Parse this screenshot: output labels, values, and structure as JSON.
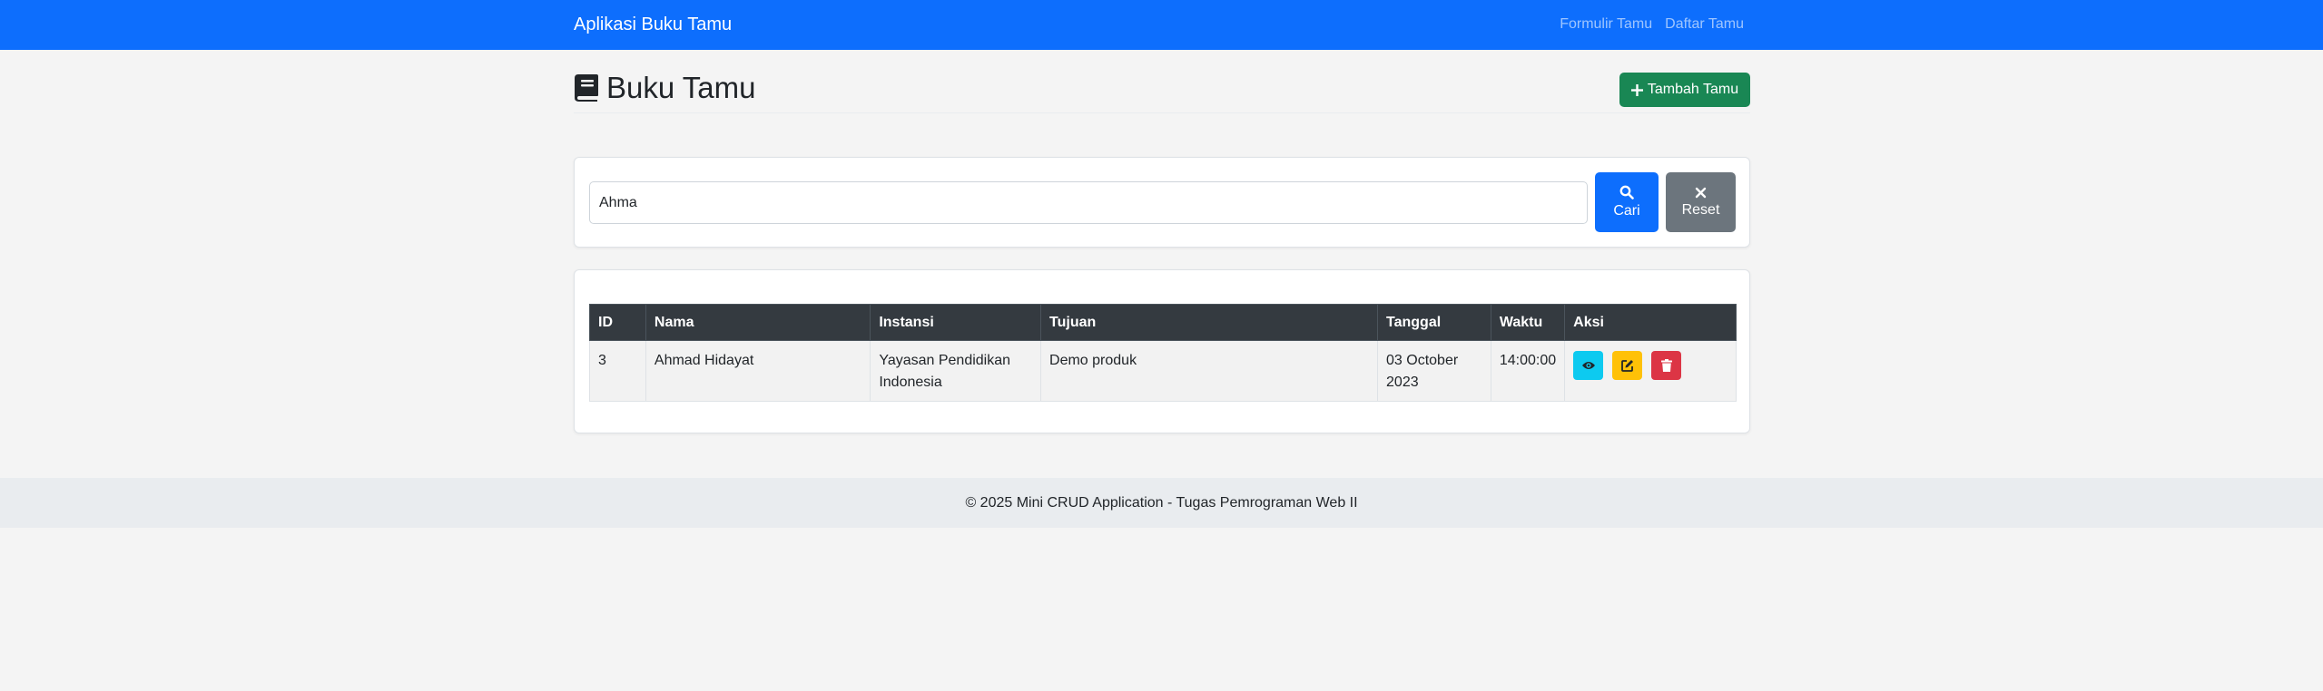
{
  "navbar": {
    "brand": "Aplikasi Buku Tamu",
    "links": [
      "Formulir Tamu",
      "Daftar Tamu"
    ]
  },
  "header": {
    "title": "Buku Tamu",
    "icon": "book-icon",
    "add_button_label": "Tambah Tamu"
  },
  "search": {
    "value": "Ahma",
    "search_label": "Cari",
    "reset_label": "Reset"
  },
  "table": {
    "columns": [
      "ID",
      "Nama",
      "Instansi",
      "Tujuan",
      "Tanggal",
      "Waktu",
      "Aksi"
    ],
    "rows": [
      {
        "id": "3",
        "nama": "Ahmad Hidayat",
        "instansi": "Yayasan Pendidikan Indonesia",
        "tujuan": "Demo produk",
        "tanggal": "03 October 2023",
        "waktu": "14:00:00",
        "actions": [
          "eye-icon",
          "edit-icon",
          "trash-icon"
        ]
      }
    ]
  },
  "footer": {
    "text": "© 2025 Mini CRUD Application - Tugas Pemrograman Web II"
  },
  "colors": {
    "primary": "#0d6efd",
    "success": "#198754",
    "secondary": "#6c757d",
    "info": "#0dcaf0",
    "warning": "#ffc107",
    "danger": "#dc3545",
    "table_header": "#343a40"
  }
}
